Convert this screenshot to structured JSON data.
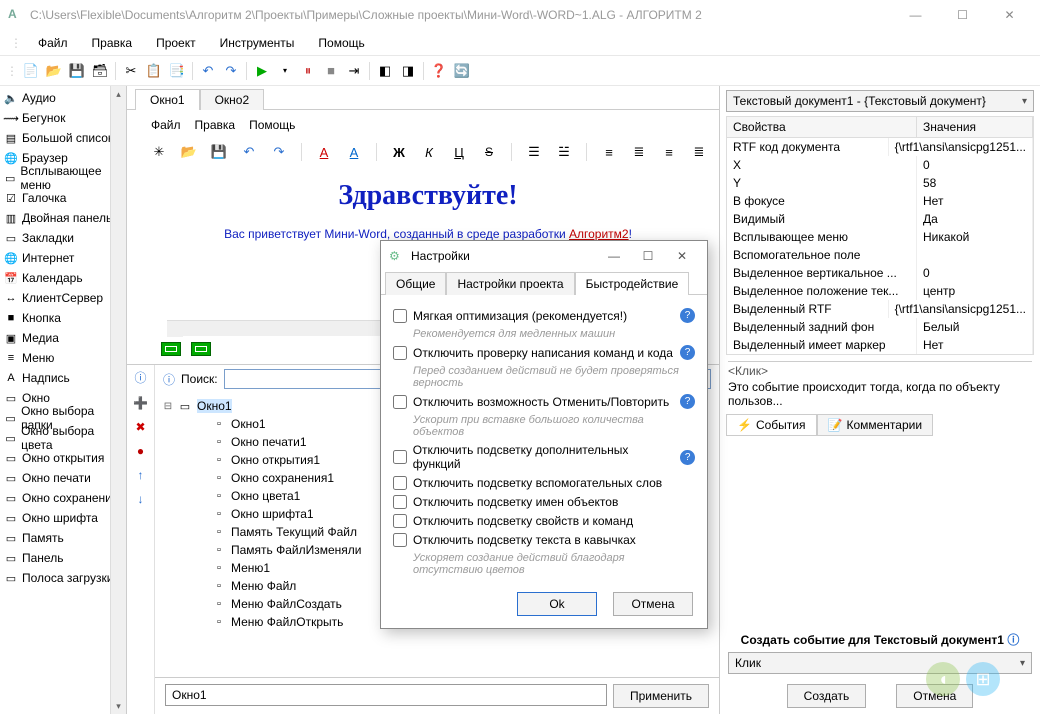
{
  "window": {
    "title": "C:\\Users\\Flexible\\Documents\\Алгоритм 2\\Проекты\\Примеры\\Сложные проекты\\Мини-Word\\-WORD~1.ALG - АЛГОРИТМ 2",
    "app_icon_char": "A"
  },
  "menu": {
    "items": [
      "Файл",
      "Правка",
      "Проект",
      "Инструменты",
      "Помощь"
    ]
  },
  "sidebar": {
    "items": [
      {
        "label": "Аудио",
        "icon": "🔈"
      },
      {
        "label": "Бегунок",
        "icon": "⟿"
      },
      {
        "label": "Большой список",
        "icon": "▤"
      },
      {
        "label": "Браузер",
        "icon": "🌐"
      },
      {
        "label": "Всплывающее меню",
        "icon": "▭"
      },
      {
        "label": "Галочка",
        "icon": "☑"
      },
      {
        "label": "Двойная панель",
        "icon": "▥"
      },
      {
        "label": "Закладки",
        "icon": "▭"
      },
      {
        "label": "Интернет",
        "icon": "🌐"
      },
      {
        "label": "Календарь",
        "icon": "📅"
      },
      {
        "label": "КлиентСервер",
        "icon": "↔"
      },
      {
        "label": "Кнопка",
        "icon": "■"
      },
      {
        "label": "Медиа",
        "icon": "▣"
      },
      {
        "label": "Меню",
        "icon": "≡"
      },
      {
        "label": "Надпись",
        "icon": "A"
      },
      {
        "label": "Окно",
        "icon": "▭"
      },
      {
        "label": "Окно выбора папки",
        "icon": "▭"
      },
      {
        "label": "Окно выбора цвета",
        "icon": "▭"
      },
      {
        "label": "Окно открытия",
        "icon": "▭"
      },
      {
        "label": "Окно печати",
        "icon": "▭"
      },
      {
        "label": "Окно сохранения",
        "icon": "▭"
      },
      {
        "label": "Окно шрифта",
        "icon": "▭"
      },
      {
        "label": "Память",
        "icon": "▭"
      },
      {
        "label": "Панель",
        "icon": "▭"
      },
      {
        "label": "Полоса загрузки",
        "icon": "▭"
      }
    ]
  },
  "doc_tabs": [
    "Окно1",
    "Окно2"
  ],
  "doc_menu": [
    "Файл",
    "Правка",
    "Помощь"
  ],
  "doc_content": {
    "heading": "Здравствуйте!",
    "line_pre": "Вас приветствует Мини-Word, созданный в среде разработки ",
    "line_hl": "Алгоритм2",
    "line_post": "!"
  },
  "tree": {
    "search_label": "Поиск:",
    "root": "Окно1",
    "children": [
      "Окно1",
      "Окно печати1",
      "Окно открытия1",
      "Окно сохранения1",
      "Окно цвета1",
      "Окно шрифта1",
      "Память Текущий Файл",
      "Память ФайлИзменяли",
      "Меню1",
      "Меню Файл",
      "Меню ФайлСоздать",
      "Меню ФайлОткрыть"
    ],
    "input_value": "Окно1",
    "apply_btn": "Применить"
  },
  "right": {
    "combo": "Текстовый документ1 - {Текстовый документ}",
    "hdr1": "Свойства",
    "hdr2": "Значения",
    "rows": [
      [
        "RTF код документа",
        "{\\rtf1\\ansi\\ansicpg1251..."
      ],
      [
        "X",
        "0"
      ],
      [
        "Y",
        "58"
      ],
      [
        "В фокусе",
        "Нет"
      ],
      [
        "Видимый",
        "Да"
      ],
      [
        "Всплывающее меню",
        "Никакой"
      ],
      [
        "Вспомогательное поле",
        ""
      ],
      [
        "Выделенное вертикальное ...",
        "0"
      ],
      [
        "Выделенное положение тек...",
        "центр"
      ],
      [
        "Выделенный RTF",
        "{\\rtf1\\ansi\\ansicpg1251..."
      ],
      [
        "Выделенный задний фон",
        "Белый"
      ],
      [
        "Выделенный имеет маркер",
        "Нет"
      ]
    ],
    "evt_header": "<Клик>",
    "evt_desc": "Это событие происходит тогда, когда по объекту пользов...",
    "evt_tabs": [
      "События",
      "Комментарии"
    ],
    "create_label": "Создать событие для Текстовый документ1",
    "create_combo": "Клик",
    "create_btn": "Создать",
    "cancel_btn": "Отмена"
  },
  "dialog": {
    "title": "Настройки",
    "tabs": [
      "Общие",
      "Настройки проекта",
      "Быстродействие"
    ],
    "active_tab": 2,
    "options": [
      {
        "label": "Мягкая оптимизация (рекомендуется!)",
        "help": true,
        "hint": "Рекомендуется для медленных машин"
      },
      {
        "label": "Отключить проверку написания команд и кода",
        "help": true,
        "hint": "Перед созданием действий не будет проверяться верность"
      },
      {
        "label": "Отключить возможность Отменить/Повторить",
        "help": true,
        "hint": "Ускорит при вставке большого количества объектов"
      },
      {
        "label": "Отключить подсветку дополнительных функций",
        "help": true
      },
      {
        "label": "Отключить подсветку вспомогательных слов"
      },
      {
        "label": "Отключить подсветку имен объектов"
      },
      {
        "label": "Отключить подсветку свойств и команд"
      },
      {
        "label": "Отключить подсветку текста в кавычках",
        "hint": "Ускоряет создание действий благодаря отсутствию цветов"
      }
    ],
    "ok": "Ok",
    "cancel": "Отмена"
  }
}
